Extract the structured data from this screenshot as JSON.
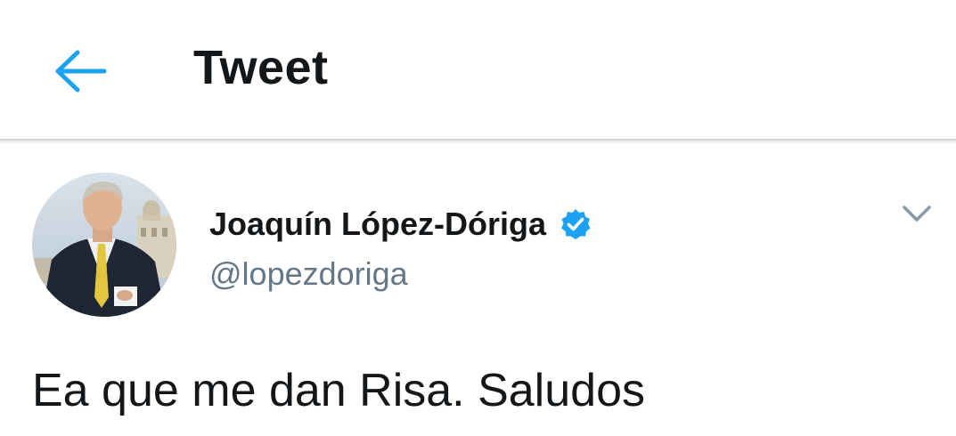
{
  "header": {
    "title": "Tweet",
    "back_icon": "arrow-left-icon",
    "accent_color": "#1da1f2"
  },
  "tweet": {
    "author": {
      "name": "Joaquín López-Dóriga",
      "handle": "@lopezdoriga",
      "verified_icon": "verified-badge-icon",
      "avatar": "profile-photo"
    },
    "menu_icon": "chevron-down-icon",
    "text": "Ea que me dan Risa. Saludos"
  }
}
